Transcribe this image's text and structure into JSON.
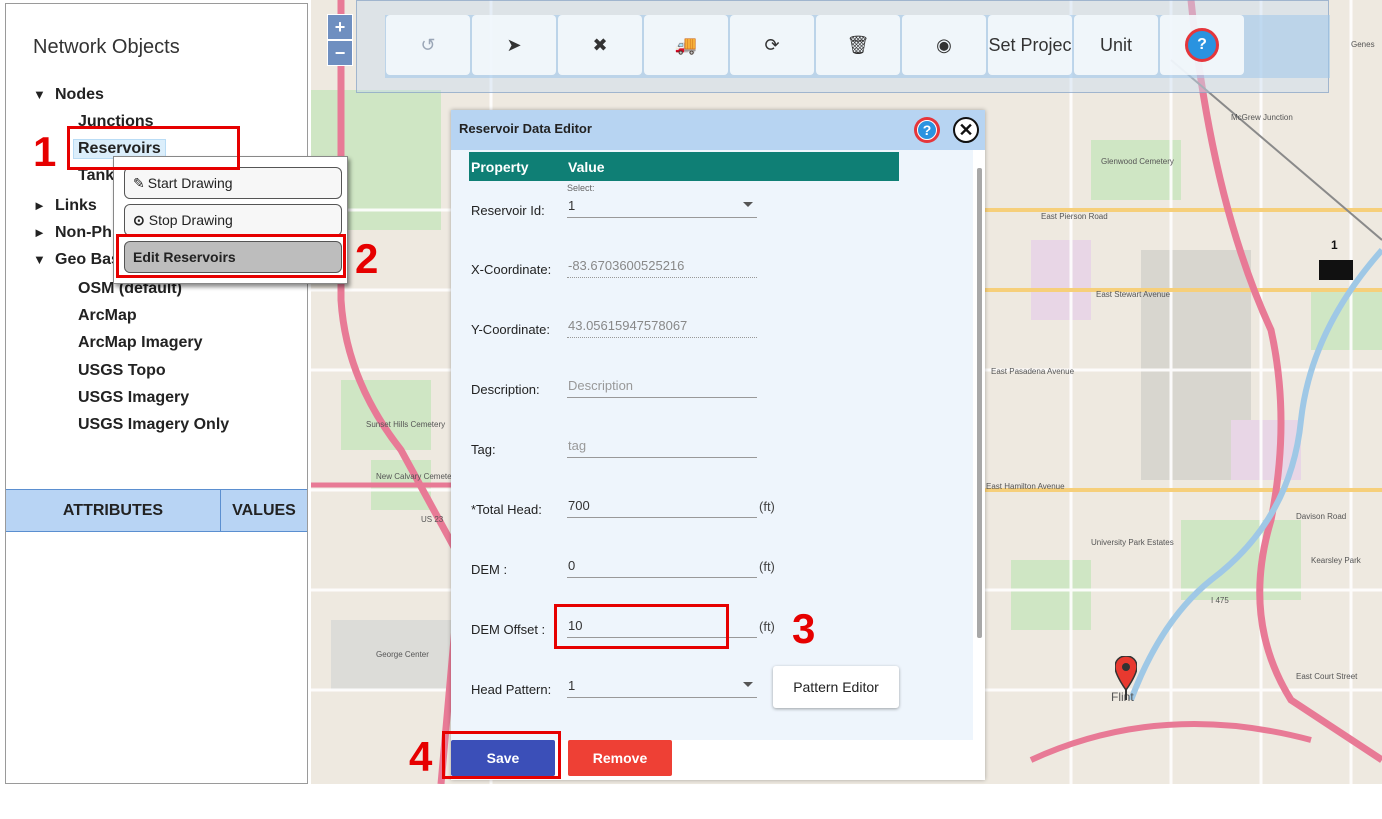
{
  "sidebar": {
    "title": "Network Objects",
    "tree": [
      {
        "label": "Nodes",
        "arrow": "▼"
      },
      {
        "label": "Links",
        "arrow": "►"
      },
      {
        "label": "Non-Ph",
        "arrow": "►"
      },
      {
        "label": "Geo Bas",
        "arrow": "▼"
      }
    ],
    "nodes_children": [
      "Junctions",
      "Reservoirs",
      "Tank"
    ],
    "geo_children": [
      "OSM (default)",
      "ArcMap",
      "ArcMap Imagery",
      "USGS Topo",
      "USGS Imagery",
      "USGS Imagery Only"
    ],
    "attributes_header": "ATTRIBUTES",
    "values_header": "VALUES"
  },
  "context_menu": {
    "start_drawing": "Start Drawing",
    "stop_drawing": "Stop Drawing",
    "edit_reservoirs": "Edit Reservoirs"
  },
  "map": {
    "zoom_in": "+",
    "zoom_out": "−",
    "labels": [
      "McGrew Junction",
      "Glenwood Cemetery",
      "East Pierson Road",
      "East Stewart Avenue",
      "East Pasadena Avenue",
      "Sunset Hills Cemetery",
      "New Calvary Cemetery",
      "George Center",
      "East Hamilton Avenue",
      "Davison Road",
      "University Park Estates",
      "Kearsley Park",
      "Flint",
      "East Court Street",
      "Genes",
      "I 475",
      "US 23"
    ],
    "marker_count_label": "1"
  },
  "toolbar": {
    "undo_icon": "undo-icon",
    "select_icon": "pointer-icon",
    "delete_icon": "x-icon",
    "move_icon": "truck-icon",
    "refresh_icon": "refresh-icon",
    "trash_icon": "trash-icon",
    "record_icon": "record-icon",
    "set_projection": "Set Projec",
    "unit": "Unit",
    "help": "?"
  },
  "dialog": {
    "title": "Reservoir Data Editor",
    "help": "?",
    "close": "✕",
    "header_property": "Property",
    "header_value": "Value",
    "select_hint": "Select:",
    "fields": {
      "reservoir_id": {
        "label": "Reservoir Id:",
        "value": "1"
      },
      "x_coord": {
        "label": "X-Coordinate:",
        "value": "-83.6703600525216"
      },
      "y_coord": {
        "label": "Y-Coordinate:",
        "value": "43.05615947578067"
      },
      "description": {
        "label": "Description:",
        "placeholder": "Description"
      },
      "tag": {
        "label": "Tag:",
        "placeholder": "tag"
      },
      "total_head": {
        "label": "*Total Head:",
        "value": "700",
        "unit": "(ft)"
      },
      "dem": {
        "label": "DEM :",
        "value": "0",
        "unit": "(ft)"
      },
      "dem_offset": {
        "label": "DEM Offset :",
        "value": "10",
        "unit": "(ft)"
      },
      "head_pattern": {
        "label": "Head Pattern:",
        "value": "1"
      }
    },
    "pattern_editor": "Pattern Editor",
    "save": "Save",
    "remove": "Remove"
  },
  "annotations": [
    "1",
    "2",
    "3",
    "4"
  ],
  "colors": {
    "accent_red": "#e60000",
    "header_teal": "#0f7f75",
    "save_blue": "#3b4fb8",
    "remove_red": "#ee4035"
  }
}
